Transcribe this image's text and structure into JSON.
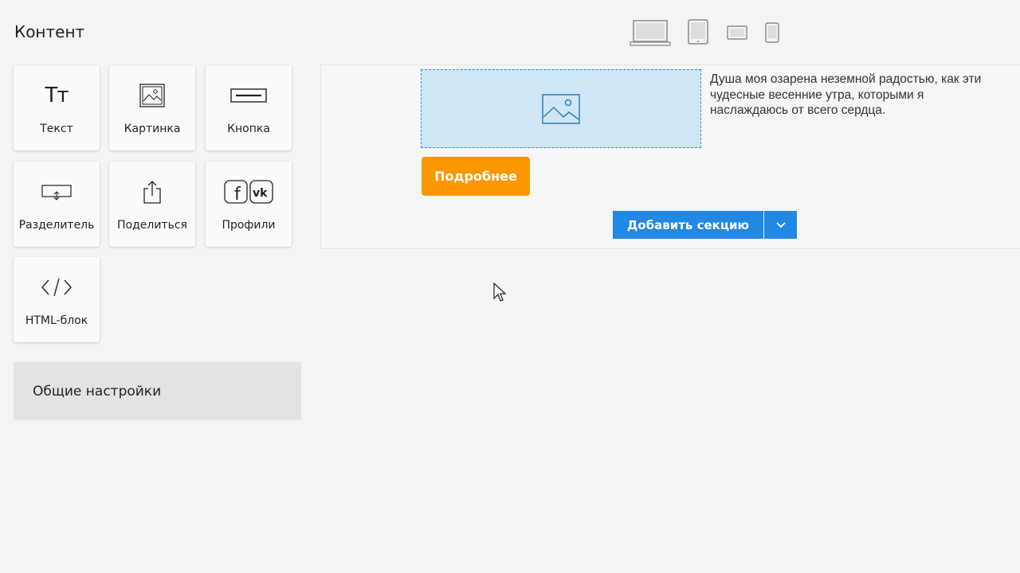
{
  "sidebar": {
    "title": "Контент",
    "tiles": [
      {
        "label": "Текст",
        "icon": "text-icon",
        "glyph": "Тт"
      },
      {
        "label": "Картинка",
        "icon": "image-icon"
      },
      {
        "label": "Кнопка",
        "icon": "button-icon"
      },
      {
        "label": "Разделитель",
        "icon": "divider-icon"
      },
      {
        "label": "Поделиться",
        "icon": "share-icon"
      },
      {
        "label": "Профили",
        "icon": "social-profiles-icon",
        "glyph_fb": "f",
        "glyph_vk": "vk"
      },
      {
        "label": "HTML-блок",
        "icon": "code-icon"
      }
    ],
    "settings_label": "Общие настройки"
  },
  "devices": [
    {
      "name": "desktop-icon"
    },
    {
      "name": "tablet-icon"
    },
    {
      "name": "tablet-landscape-icon"
    },
    {
      "name": "mobile-icon"
    }
  ],
  "canvas": {
    "image_placeholder_icon": "image-icon",
    "text": "Душа моя озарена неземной радостью, как эти чудесные весенние утра, которыми я наслаждаюсь от всего сердца.",
    "button_label": "Подробнее",
    "add_section_label": "Добавить секцию",
    "add_section_toggle_icon": "chevron-down-icon"
  },
  "colors": {
    "accent_orange": "#fb9700",
    "accent_blue": "#2188e3",
    "placeholder_fill": "#cfe6f5",
    "placeholder_border": "#2f8fd0"
  }
}
